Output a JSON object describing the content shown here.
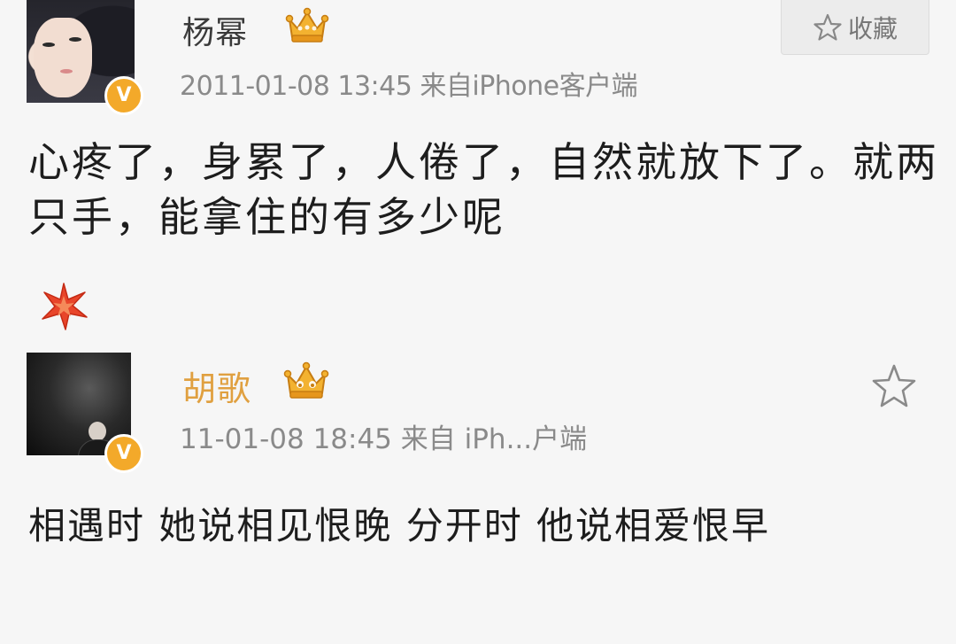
{
  "post1": {
    "author_name": "杨幂",
    "meta_text": "2011-01-08 13:45  来自iPhone客户端",
    "favorite_label": "收藏",
    "content": "心疼了，身累了，人倦了，自然就放下了。就两只手，能拿住的有多少呢",
    "verified_badge": "V",
    "icons": {
      "crown": "crown-icon",
      "star": "star-outline-icon",
      "emoji": "sparkle-emoji-icon"
    }
  },
  "post2": {
    "author_name": "胡歌",
    "meta_text": "11-01-08 18:45  来自 iPh...户端",
    "content": "相遇时 她说相见恨晚 分开时 他说相爱恨早",
    "verified_badge": "V",
    "icons": {
      "crown": "crown-icon",
      "star": "star-outline-icon"
    }
  },
  "colors": {
    "verified_badge": "#f3a92a",
    "name_highlight": "#e0a040",
    "meta_text": "#8a8a8a",
    "background": "#f6f6f6"
  }
}
